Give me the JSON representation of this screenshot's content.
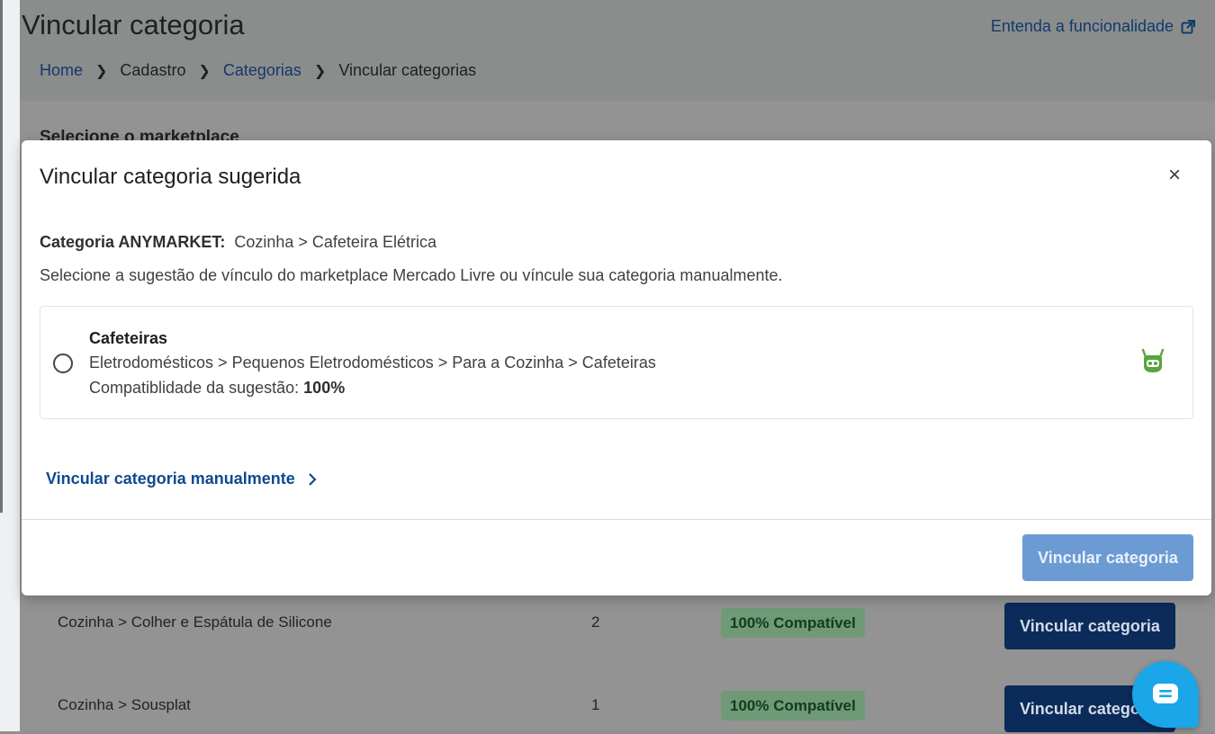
{
  "page": {
    "title": "Vincular categoria",
    "help_link": "Entenda a funcionalidade",
    "breadcrumb": [
      {
        "label": "Home",
        "link": true
      },
      {
        "label": "Cadastro",
        "link": false
      },
      {
        "label": "Categorias",
        "link": true
      },
      {
        "label": "Vincular categorias",
        "link": false
      }
    ],
    "section_label": "Selecione o marketplace"
  },
  "table": {
    "rows": [
      {
        "category": "Cozinha > Colher e Espátula de Silicone",
        "count": "2",
        "badge": "100% Compatível",
        "action": "Vincular categoria"
      },
      {
        "category": "Cozinha > Sousplat",
        "count": "1",
        "badge": "100% Compatível",
        "action": "Vincular categoria"
      }
    ]
  },
  "modal": {
    "title": "Vincular categoria sugerida",
    "close_label": "×",
    "category_label": "Categoria ANYMARKET:",
    "category_value": "Cozinha > Cafeteira Elétrica",
    "instruction": "Selecione a sugestão de vínculo do marketplace Mercado Livre ou víncule sua categoria manualmente.",
    "suggestion": {
      "name": "Cafeteiras",
      "path": "Eletrodomésticos > Pequenos Eletrodomésticos > Para a Cozinha > Cafeteiras",
      "compat_label": "Compatiblidade da sugestão:",
      "compat_value": "100%",
      "icon": "robot-icon",
      "selected": false
    },
    "manual_link": "Vincular categoria manualmente",
    "confirm_button": "Vincular categoria"
  },
  "colors": {
    "primary": "#0b2b5b",
    "link": "#0f4a8e",
    "confirm_disabled": "#6c9bd4",
    "badge_bg": "#6f9a75",
    "robot": "#5aa33f",
    "chat": "#1aa6e8"
  }
}
